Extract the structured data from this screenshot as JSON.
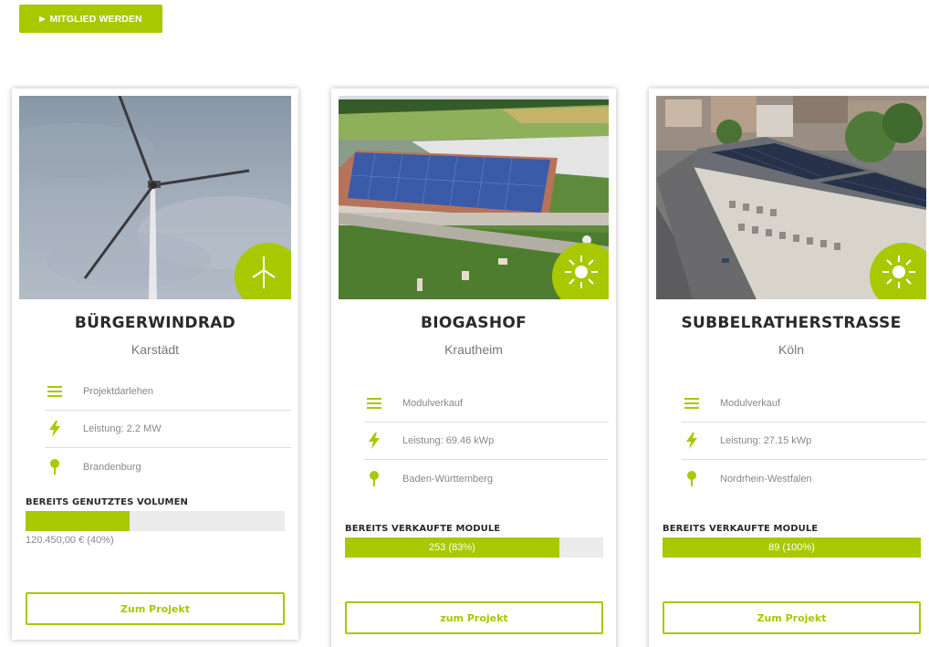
{
  "header": {
    "join_label": "MITGLIED WERDEN"
  },
  "colors": {
    "accent": "#a8c800",
    "bar_track": "#ebebeb"
  },
  "cards": [
    {
      "title": "BÜRGERWINDRAD",
      "city": "Karstädt",
      "type_icon": "wind-turbine-icon",
      "info": [
        {
          "icon": "list-icon",
          "text": "Projektdarlehen"
        },
        {
          "icon": "lightning-icon",
          "text": "Leistung: 2.2 MW"
        },
        {
          "icon": "location-pin-icon",
          "text": "Brandenburg"
        }
      ],
      "progress_label": "BEREITS GENUTZTES VOLUMEN",
      "progress_fraction": 0.4,
      "progress_inline_text": "",
      "progress_caption": "120.450,00 € (40%)",
      "button_label": "Zum Projekt"
    },
    {
      "title": "BIOGASHOF",
      "city": "Krautheim",
      "type_icon": "sun-icon",
      "info": [
        {
          "icon": "list-icon",
          "text": "Modulverkauf"
        },
        {
          "icon": "lightning-icon",
          "text": "Leistung: 69.46 kWp"
        },
        {
          "icon": "location-pin-icon",
          "text": "Baden-Württemberg"
        }
      ],
      "progress_label": "BEREITS VERKAUFTE MODULE",
      "progress_fraction": 0.83,
      "progress_inline_text": "253 (83%)",
      "progress_caption": "",
      "button_label": "zum Projekt"
    },
    {
      "title": "SUBBELRATHERSTRASSE",
      "city": "Köln",
      "type_icon": "sun-icon",
      "info": [
        {
          "icon": "list-icon",
          "text": "Modulverkauf"
        },
        {
          "icon": "lightning-icon",
          "text": "Leistung: 27.15 kWp"
        },
        {
          "icon": "location-pin-icon",
          "text": "Nordrhein-Westfalen"
        }
      ],
      "progress_label": "BEREITS VERKAUFTE MODULE",
      "progress_fraction": 1.0,
      "progress_inline_text": "89 (100%)",
      "progress_caption": "",
      "button_label": "Zum Projekt"
    }
  ]
}
